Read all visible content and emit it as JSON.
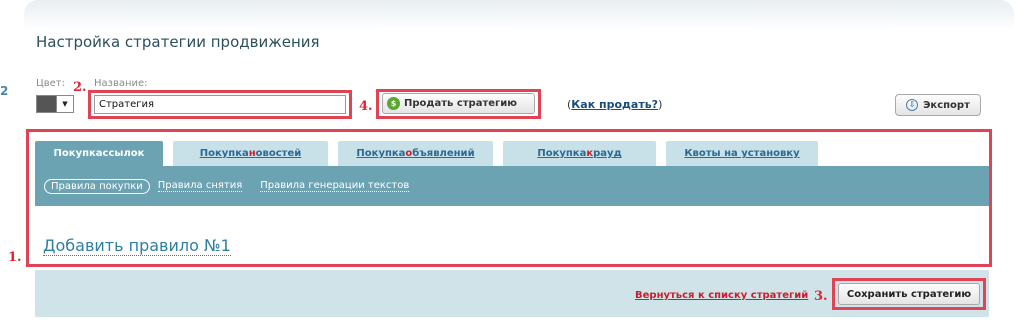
{
  "header": {
    "title": "Настройка стратегии продвижения",
    "edge_number": "2"
  },
  "form": {
    "color_label": "Цвет:",
    "name_label": "Название:",
    "name_value": "Стратегия",
    "sell_button": "Продать стратегию",
    "how_sell_open": "(",
    "how_sell_link": "Как продать?",
    "how_sell_close": ")",
    "export_button": "Экспорт"
  },
  "markers": {
    "m1": "1.",
    "m2": "2.",
    "m3": "3.",
    "m4": "4."
  },
  "tabs": [
    {
      "pre": "Покупка ",
      "hl": "с",
      "post": "сылок"
    },
    {
      "pre": "Покупка ",
      "hl": "н",
      "post": "овостей"
    },
    {
      "pre": "Покупка ",
      "hl": "о",
      "post": "бъявлений"
    },
    {
      "pre": "Покупка ",
      "hl": "к",
      "post": "рауд"
    },
    {
      "pre": "Квоты на установку",
      "hl": "",
      "post": ""
    }
  ],
  "subnav": {
    "active": "Правила покупки",
    "items": [
      "Правила снятия",
      "Правила генерации текстов"
    ]
  },
  "content": {
    "add_rule": "Добавить правило №1"
  },
  "footer": {
    "back_link": "Вернуться к списку стратегий",
    "save_button": "Сохранить стратегию"
  },
  "colors": {
    "tab_active": "#6ba3b3",
    "tab_inactive": "#c8e0e8",
    "highlight_red": "#e04454",
    "footer": "#cfe3e9"
  },
  "icons": {
    "sell": "coin-icon",
    "export": "export-icon",
    "color_dropdown": "chevron-down-icon"
  }
}
